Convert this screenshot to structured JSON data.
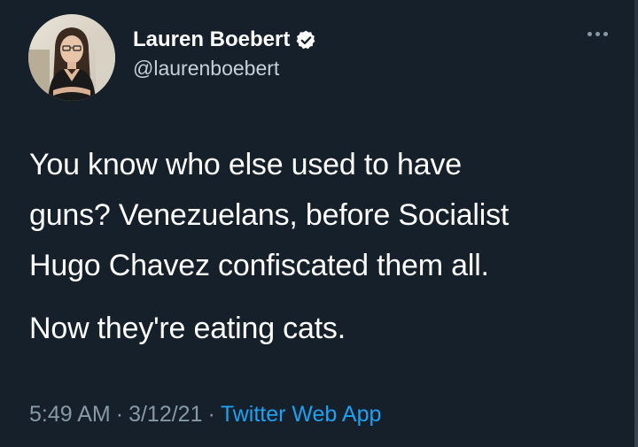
{
  "tweet": {
    "author": {
      "display_name": "Lauren Boebert",
      "handle": "@laurenboebert",
      "verified": true
    },
    "text_lines": [
      "You know who else used to have",
      "guns? Venezuelans, before Socialist",
      "Hugo Chavez confiscated them all."
    ],
    "text_paragraph_2": "Now they're eating cats.",
    "time": "5:49 AM",
    "separator": "·",
    "date": "3/12/21",
    "source": "Twitter Web App"
  },
  "icons": {
    "more": "more-horizontal-icon",
    "verified": "verified-badge-icon"
  },
  "colors": {
    "background": "#15202b",
    "text": "#ffffff",
    "secondary": "#8899a6",
    "link": "#1da1f2"
  }
}
